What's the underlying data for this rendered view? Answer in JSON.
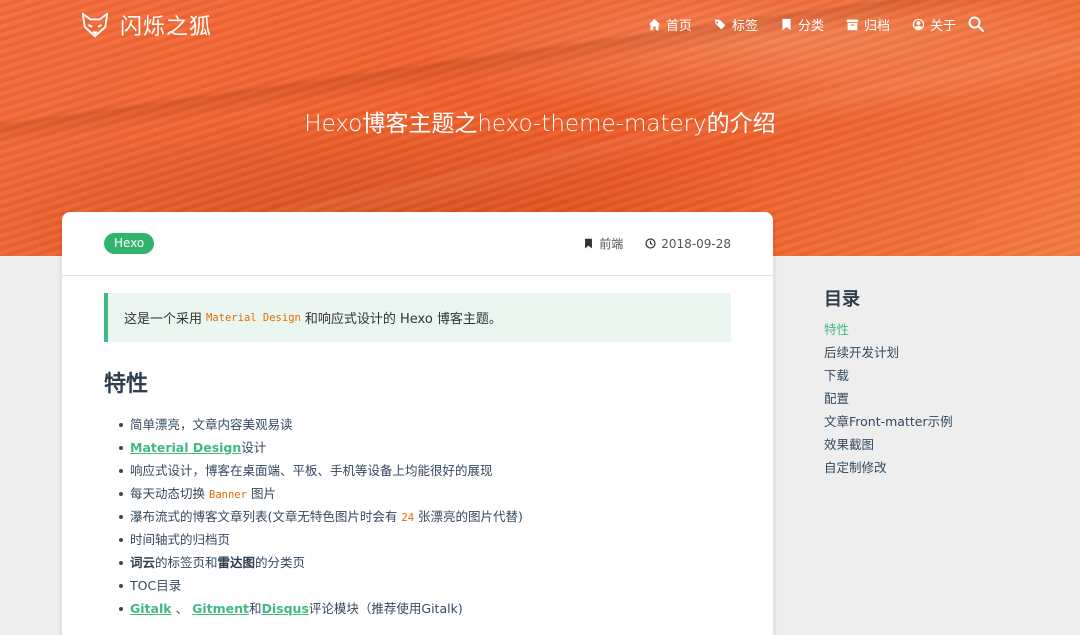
{
  "brand": {
    "name": "闪烁之狐"
  },
  "nav": [
    {
      "label": "首页",
      "icon": "home-icon"
    },
    {
      "label": "标签",
      "icon": "tags-icon"
    },
    {
      "label": "分类",
      "icon": "bookmark-icon"
    },
    {
      "label": "归档",
      "icon": "archive-icon"
    },
    {
      "label": "关于",
      "icon": "user-circle-icon"
    }
  ],
  "hero": {
    "title": "Hexo博客主题之hexo-theme-matery的介绍"
  },
  "post": {
    "tag": "Hexo",
    "category": "前端",
    "date": "2018-09-28",
    "notice": {
      "prefix": "这是一个采用",
      "code": "Material Design",
      "suffix": "和响应式设计的 Hexo 博客主题。"
    },
    "section_title": "特性",
    "features": {
      "f1": "简单漂亮，文章内容美观易读",
      "f2_link": "Material Design",
      "f2_text": "设计",
      "f3": "响应式设计，博客在桌面端、平板、手机等设备上均能很好的展现",
      "f4_prefix": "每天动态切换",
      "f4_code": "Banner",
      "f4_suffix": "图片",
      "f5_prefix": "瀑布流式的博客文章列表(文章无特色图片时会有",
      "f5_code": "24",
      "f5_suffix": "张漂亮的图片代替)",
      "f6": "时间轴式的归档页",
      "f7_b1": "词云",
      "f7_t1": "的标签页和",
      "f7_b2": "雷达图",
      "f7_t2": "的分类页",
      "f8": "TOC目录",
      "f9_l1": "Gitalk",
      "f9_sep": "、",
      "f9_l2": "Gitment",
      "f9_and": "和",
      "f9_l3": "Disqus",
      "f9_tail": "评论模块（推荐使用Gitalk)"
    }
  },
  "toc": {
    "title": "目录",
    "items": [
      "特性",
      "后续开发计划",
      "下载",
      "配置",
      "文章Front-matter示例",
      "效果截图",
      "自定制修改"
    ]
  },
  "colors": {
    "accent": "#42b983",
    "banner": "#f2622d",
    "tag": "#30b36b",
    "code": "#e96900"
  }
}
